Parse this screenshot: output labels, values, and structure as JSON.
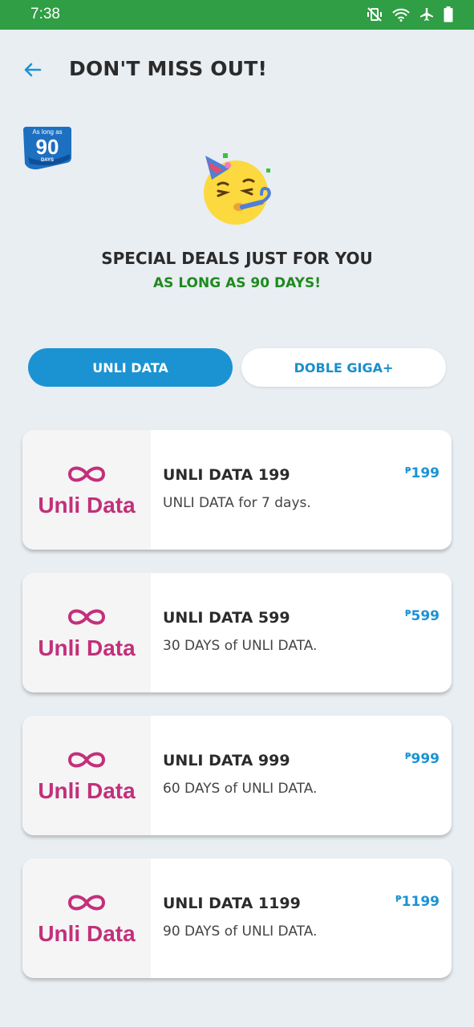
{
  "status_bar": {
    "time": "7:38",
    "icons": [
      "vibrate-off-icon",
      "wifi-icon",
      "airplane-icon",
      "battery-icon"
    ]
  },
  "header": {
    "title": "DON'T MISS OUT!",
    "back_icon": "arrow-left-icon"
  },
  "badge": {
    "top_text": "As long as",
    "number": "90",
    "bottom_text": "DAYS"
  },
  "promo": {
    "emoji": "party-face-icon",
    "title": "SPECIAL DEALS JUST FOR YOU",
    "subtitle": "AS LONG AS 90 DAYS!"
  },
  "tabs": [
    {
      "label": "UNLI DATA",
      "active": true
    },
    {
      "label": "DOBLE GIGA+",
      "active": false
    }
  ],
  "offers": [
    {
      "logo_text": "Unli Data",
      "name": "UNLI DATA 199",
      "description": "UNLI DATA for 7 days.",
      "currency": "₱",
      "price": "199"
    },
    {
      "logo_text": "Unli Data",
      "name": "UNLI DATA 599",
      "description": "30 DAYS of UNLI DATA.",
      "currency": "₱",
      "price": "599"
    },
    {
      "logo_text": "Unli Data",
      "name": "UNLI DATA 999",
      "description": "60 DAYS of UNLI DATA.",
      "currency": "₱",
      "price": "999"
    },
    {
      "logo_text": "Unli Data",
      "name": "UNLI DATA 1199",
      "description": "90 DAYS of UNLI DATA.",
      "currency": "₱",
      "price": "1199"
    }
  ],
  "colors": {
    "status_bar": "#2f9e44",
    "accent": "#1b93d3",
    "subtitle_green": "#1f8a1f",
    "logo_magenta": "#c2307a",
    "background": "#e9eef2"
  }
}
